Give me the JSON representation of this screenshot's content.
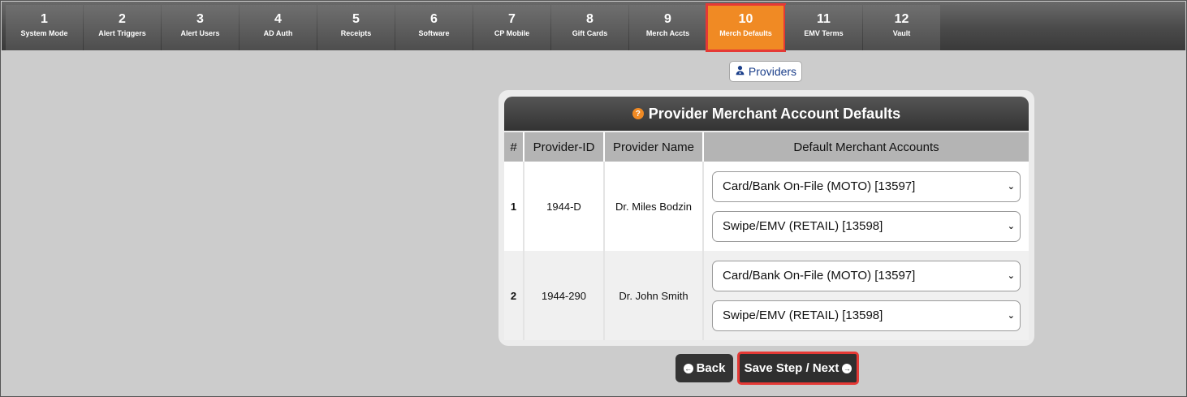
{
  "steps": [
    {
      "num": "1",
      "label": "System Mode"
    },
    {
      "num": "2",
      "label": "Alert Triggers"
    },
    {
      "num": "3",
      "label": "Alert Users"
    },
    {
      "num": "4",
      "label": "AD Auth"
    },
    {
      "num": "5",
      "label": "Receipts"
    },
    {
      "num": "6",
      "label": "Software"
    },
    {
      "num": "7",
      "label": "CP Mobile"
    },
    {
      "num": "8",
      "label": "Gift Cards"
    },
    {
      "num": "9",
      "label": "Merch Accts"
    },
    {
      "num": "10",
      "label": "Merch Defaults",
      "active": true
    },
    {
      "num": "11",
      "label": "EMV Terms"
    },
    {
      "num": "12",
      "label": "Vault"
    }
  ],
  "providers_button": "Providers",
  "panel": {
    "title": "Provider Merchant Account Defaults",
    "columns": [
      "#",
      "Provider-ID",
      "Provider Name",
      "Default Merchant Accounts"
    ],
    "rows": [
      {
        "index": "1",
        "provider_id": "1944-D",
        "provider_name": "Dr. Miles Bodzin",
        "accounts": [
          "Card/Bank On-File (MOTO) [13597]",
          "Swipe/EMV (RETAIL) [13598]"
        ]
      },
      {
        "index": "2",
        "provider_id": "1944-290",
        "provider_name": "Dr. John Smith",
        "accounts": [
          "Card/Bank On-File (MOTO) [13597]",
          "Swipe/EMV (RETAIL) [13598]"
        ]
      }
    ]
  },
  "buttons": {
    "back": "Back",
    "save_next": "Save Step / Next"
  },
  "colors": {
    "active_step": "#f08a24",
    "highlight": "#e53935",
    "header_bg": "#333333",
    "page_bg": "#cccccc"
  },
  "icons": {
    "help": "question-circle-icon",
    "providers": "user-doctor-icon",
    "back": "arrow-circle-left-icon",
    "next": "arrow-circle-right-icon",
    "select": "chevron-down-icon"
  }
}
